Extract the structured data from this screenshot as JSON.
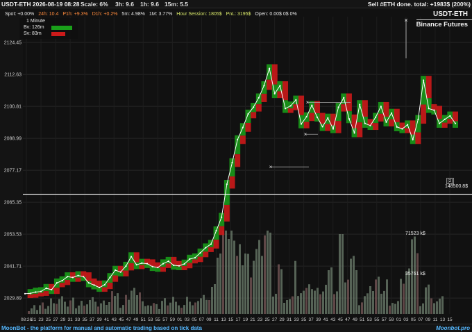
{
  "topbar": {
    "title": "USDT-ETH 2026-08-19 08:28",
    "scale": "Scale: 6%",
    "h3": "3h:  9.6",
    "h1": "1h:  9.6",
    "m15": "15m:  5.5",
    "status": "Sell #ETH done. total: +1983$ (200%)"
  },
  "stats": {
    "spot": "Spot: +0.00%",
    "h24": "24h: 10.4",
    "p1h": "P1h: +9.3%",
    "d1h": "D1h: +0.2%",
    "m5": "5m: 4.98%",
    "m1": "1M: 3.77%",
    "hour_session": "Hour Session: 1805$",
    "pnl": "PnL: 3195$",
    "open": "Open: 0.00$  0$  0%"
  },
  "legend": {
    "interval": "1 Minute",
    "bv": "Bv: 126m",
    "sv": "Sv: 83m"
  },
  "right": {
    "pair": "USDT-ETH",
    "exchange": "Binance Futures",
    "hline_tag": "[2]",
    "hline_value": "148500.8$",
    "vol_max": "71523 k$",
    "vol_mid": "35761 k$"
  },
  "bottombar": {
    "text": "MoonBot - the platform for manual and automatic trading based on tick data",
    "brand": "Moonbot.pro"
  },
  "colors": {
    "bg": "#111111",
    "grid": "#262626",
    "buy": "#1a9a1a",
    "sell": "#cc1a1a",
    "vol": "#6d7f6d",
    "price": "#ffffff",
    "link": "#55b8ff"
  },
  "chart_data": {
    "type": "line",
    "ylim": [
      2024,
      2134
    ],
    "y_ticks": [
      "2124.45",
      "2112.63",
      "2100.81",
      "2088.99",
      "2077.17",
      "2065.35",
      "2053.53",
      "2041.71",
      "2029.89"
    ],
    "y_tick_values": [
      2124.45,
      2112.63,
      2100.81,
      2088.99,
      2077.17,
      2065.35,
      2053.53,
      2041.71,
      2029.89
    ],
    "x_ticks": [
      "08:26",
      "21",
      "23",
      "25",
      "27",
      "29",
      "31",
      "33",
      "35",
      "37",
      "39",
      "41",
      "43",
      "45",
      "47",
      "49",
      "51",
      "53",
      "55",
      "57",
      "59",
      "01",
      "03",
      "05",
      "07",
      "09",
      "11",
      "13",
      "15",
      "17",
      "19",
      "21",
      "23",
      "25",
      "27",
      "29",
      "31",
      "33",
      "35",
      "37",
      "39",
      "41",
      "43",
      "45",
      "47",
      "49",
      "51",
      "53",
      "55",
      "57",
      "59",
      "01",
      "03",
      "05",
      "07",
      "09",
      "11",
      "13",
      "15"
    ],
    "horizontal_line": 2068.2,
    "series": [
      {
        "x": [
          0,
          1,
          2,
          3,
          4,
          5,
          6,
          7,
          8,
          9,
          10,
          11,
          12,
          13,
          14,
          15,
          16,
          17,
          18,
          19,
          20,
          21,
          22,
          23,
          24,
          25,
          26,
          27,
          28,
          29,
          30,
          31,
          32,
          33,
          34,
          35,
          36,
          37,
          38,
          39,
          40,
          41,
          42,
          43,
          44,
          45,
          46,
          47,
          48,
          49,
          50,
          51,
          52,
          53,
          54,
          55,
          56,
          57,
          58,
          59,
          60,
          61,
          62,
          63,
          64,
          65,
          66,
          67,
          68,
          69,
          70,
          71,
          72,
          73,
          74,
          75,
          76,
          77,
          78,
          79,
          80,
          81
        ],
        "values": [
          2031.5,
          2031.6,
          2032.1,
          2032.3,
          2033.5,
          2033,
          2035.5,
          2036.3,
          2037.8,
          2037.5,
          2038.2,
          2037.8,
          2035.5,
          2034.7,
          2033.8,
          2034.8,
          2037.5,
          2040.2,
          2039.5,
          2041.7,
          2045.2,
          2042.2,
          2042.8,
          2042.6,
          2041.5,
          2041.2,
          2042.6,
          2043.5,
          2042,
          2041.8,
          2042.5,
          2044.3,
          2044.8,
          2046.6,
          2048.5,
          2049.8,
          2054.8,
          2059.8,
          2072,
          2080,
          2088.5,
          2093,
          2098,
          2100.5,
          2104,
          2108.5,
          2114.8,
          2105.5,
          2108.5,
          2100,
          2101,
          2103.2,
          2094.3,
          2097,
          2101.2,
          2096.8,
          2093.3,
          2096.5,
          2092.5,
          2100.5,
          2104,
          2096.2,
          2091,
          2101.5,
          2094.5,
          2093.7,
          2096.8,
          2100.8,
          2095,
          2098.3,
          2093.2,
          2092.5,
          2094,
          2088.5,
          2096,
          2110.5,
          2100,
          2099.4,
          2094.5,
          2096,
          2097.3,
          2094.5
        ]
      }
    ]
  }
}
